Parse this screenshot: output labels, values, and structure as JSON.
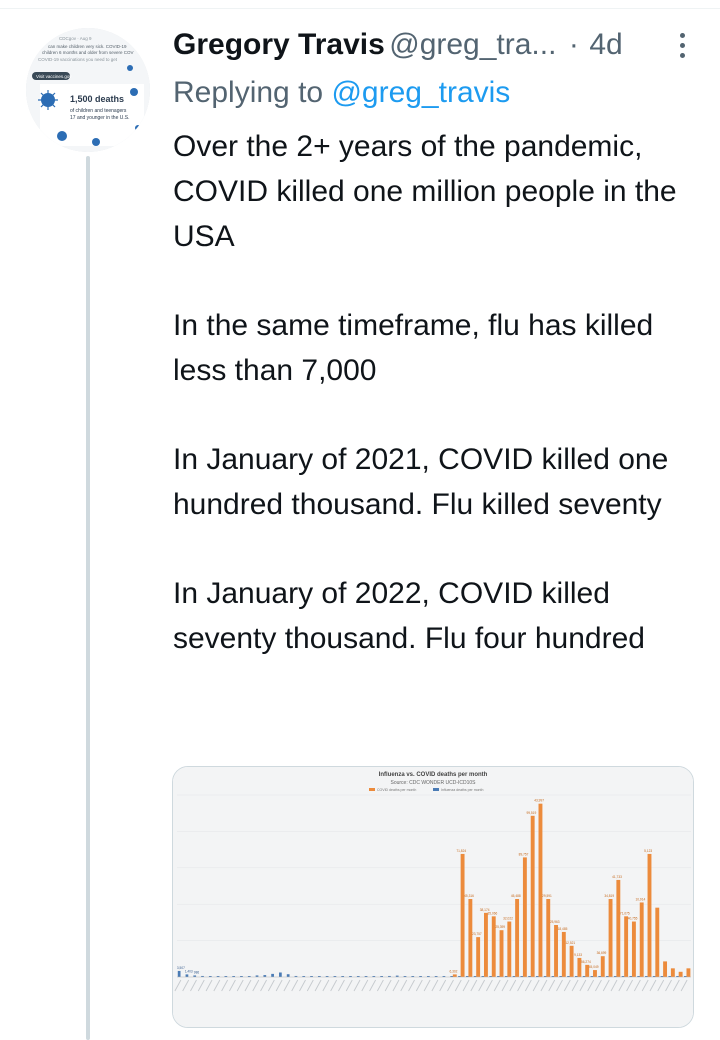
{
  "tweet": {
    "author_name": "Gregory Travis",
    "author_handle": "@greg_tra...",
    "separator": "·",
    "age": "4d",
    "replying_prefix": "Replying to",
    "replying_to": "@greg_travis",
    "paragraphs": [
      "Over the 2+ years of the pandemic, COVID killed one million people in the USA",
      "In the same timeframe, flu has killed less than 7,000",
      "In January of 2021, COVID killed one hundred thousand.  Flu killed seventy",
      "In January of 2022, COVID killed seventy thousand.  Flu four hundred"
    ]
  },
  "avatar": {
    "header_text": "CDCgov · Aug 9",
    "line1": "can make children very sick. COVID-19",
    "line2": "children 6 months and older from severe COV",
    "line3": "COVID-19 vaccinations you need to get",
    "button": "Visit vaccines.gov",
    "headline": "1,500 deaths",
    "sub1": "of children and teenagers",
    "sub2": "17 and younger in the U.S."
  },
  "chart_data": {
    "type": "bar",
    "title": "Influenza vs. COVID deaths per month",
    "subtitle": "Source: CDC WONDER UCD-ICD10S",
    "series": [
      {
        "name": "COVID deaths per month",
        "color": "#ec8b3c",
        "values": [
          0,
          0,
          0,
          0,
          0,
          0,
          0,
          0,
          0,
          0,
          0,
          0,
          0,
          0,
          0,
          0,
          0,
          0,
          0,
          0,
          0,
          0,
          0,
          0,
          0,
          0,
          0,
          0,
          0,
          0,
          0,
          0,
          0,
          0,
          0,
          1500,
          71000,
          45000,
          23000,
          37000,
          35000,
          27000,
          32000,
          45000,
          69000,
          93000,
          100000,
          45000,
          30000,
          26000,
          18000,
          11000,
          7000,
          4000,
          12000,
          45000,
          56000,
          35000,
          32000,
          43000,
          71000,
          40000,
          9000,
          5000,
          3000,
          5000
        ]
      },
      {
        "name": "Influenza deaths per month",
        "color": "#4a7bb5",
        "values": [
          3500,
          1500,
          900,
          600,
          500,
          400,
          300,
          300,
          350,
          500,
          900,
          1100,
          1800,
          2600,
          1600,
          600,
          400,
          300,
          300,
          350,
          300,
          300,
          350,
          400,
          450,
          500,
          450,
          600,
          800,
          500,
          400,
          300,
          200,
          150,
          100,
          80,
          70,
          60,
          40,
          30,
          30,
          30,
          30,
          30,
          40,
          60,
          70,
          60,
          40,
          30,
          30,
          30,
          40,
          60,
          100,
          200,
          400,
          350,
          200,
          100,
          80,
          60,
          50,
          40,
          30,
          30
        ]
      }
    ],
    "data_labels": [
      {
        "i": 0,
        "text": "3,507"
      },
      {
        "i": 1,
        "text": "1,403"
      },
      {
        "i": 2,
        "text": "986"
      },
      {
        "i": 35,
        "text": "6,302"
      },
      {
        "i": 36,
        "text": "71,824"
      },
      {
        "i": 37,
        "text": "45,316"
      },
      {
        "i": 38,
        "text": "23,757"
      },
      {
        "i": 39,
        "text": "38,174"
      },
      {
        "i": 40,
        "text": "35,066"
      },
      {
        "i": 41,
        "text": "25,399"
      },
      {
        "i": 42,
        "text": "32,022"
      },
      {
        "i": 43,
        "text": "45,488"
      },
      {
        "i": 44,
        "text": "89,757"
      },
      {
        "i": 45,
        "text": "99,519"
      },
      {
        "i": 46,
        "text": "43,997"
      },
      {
        "i": 47,
        "text": "29,591"
      },
      {
        "i": 48,
        "text": "25,963"
      },
      {
        "i": 49,
        "text": "18,485"
      },
      {
        "i": 50,
        "text": "12,521"
      },
      {
        "i": 51,
        "text": "9,133"
      },
      {
        "i": 52,
        "text": "56,274"
      },
      {
        "i": 53,
        "text": "45,049"
      },
      {
        "i": 54,
        "text": "36,699"
      },
      {
        "i": 55,
        "text": "34,819"
      },
      {
        "i": 56,
        "text": "41,733"
      },
      {
        "i": 57,
        "text": "71,075"
      },
      {
        "i": 58,
        "text": "40,755"
      },
      {
        "i": 59,
        "text": "10,914"
      },
      {
        "i": 60,
        "text": "5,123"
      }
    ],
    "ylim": [
      0,
      105000
    ],
    "grid": true,
    "legend": "top"
  }
}
